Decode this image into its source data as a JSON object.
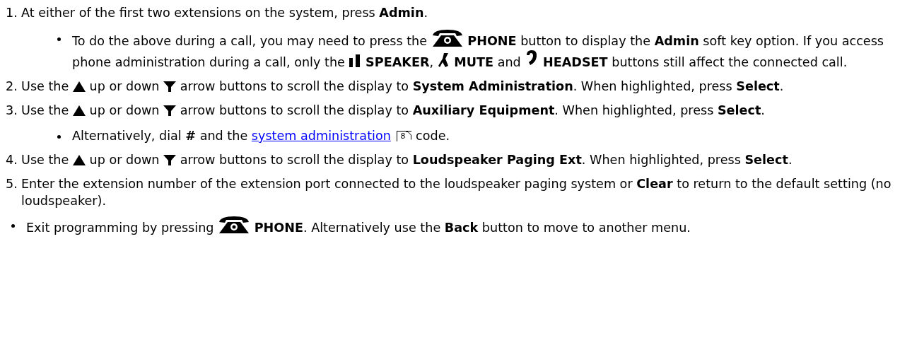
{
  "steps": [
    {
      "number": "1.",
      "parts": [
        {
          "kind": "text",
          "text": "At either of the first two extensions on the system, press **Admin**."
        }
      ],
      "notes": [
        {
          "parts": [
            {
              "kind": "text",
              "text": "To do the above during a call, you may need to press the"
            },
            {
              "kind": "phone"
            },
            {
              "kind": "text",
              "text": "**PHONE** button to display the **Admin** soft key option. If you access phone administration during a call, only the"
            },
            {
              "kind": "speaker"
            },
            {
              "kind": "text",
              "text": "**SPEAKER**,"
            },
            {
              "kind": "mute"
            },
            {
              "kind": "text",
              "text": "**MUTE** and"
            },
            {
              "kind": "headset"
            },
            {
              "kind": "text",
              "text": "**HEADSET** buttons still affect the connected call."
            }
          ]
        }
      ]
    },
    {
      "number": "2.",
      "parts": [
        {
          "kind": "text",
          "text": "Use the"
        },
        {
          "kind": "up"
        },
        {
          "kind": "text",
          "text": "up or down"
        },
        {
          "kind": "down"
        },
        {
          "kind": "text",
          "text": "arrow buttons to scroll the display to **System Administration**. When highlighted, press **Select**."
        }
      ]
    },
    {
      "number": "3.",
      "parts": [
        {
          "kind": "text",
          "text": "Use the"
        },
        {
          "kind": "up"
        },
        {
          "kind": "text",
          "text": "up or down"
        },
        {
          "kind": "down"
        },
        {
          "kind": "text",
          "text": "arrow buttons to scroll the display to **Auxiliary Equipment**. When highlighted, press **Select**."
        }
      ],
      "notes": [
        {
          "parts": [
            {
              "kind": "text",
              "text": "Alternatively, dial **#** and the"
            },
            {
              "kind": "link",
              "text": "system administration"
            },
            {
              "kind": "pageref",
              "text": "8"
            },
            {
              "kind": "text",
              "text": "code."
            }
          ]
        }
      ]
    },
    {
      "number": "4.",
      "parts": [
        {
          "kind": "text",
          "text": "Use the"
        },
        {
          "kind": "up"
        },
        {
          "kind": "text",
          "text": "up or down"
        },
        {
          "kind": "down"
        },
        {
          "kind": "text",
          "text": "arrow buttons to scroll the display to **Loudspeaker Paging Ext**. When highlighted, press **Select**."
        }
      ]
    },
    {
      "number": "5.",
      "parts": [
        {
          "kind": "text",
          "text": "Enter the extension number of the extension port connected to the loudspeaker paging system or **Clear** to return to the default setting (no loudspeaker)."
        }
      ]
    }
  ],
  "final_note": {
    "parts": [
      {
        "kind": "text",
        "text": "Exit programming by pressing"
      },
      {
        "kind": "phone"
      },
      {
        "kind": "text",
        "text": "**PHONE**. Alternatively use the **Back** button to move to another menu."
      }
    ]
  }
}
